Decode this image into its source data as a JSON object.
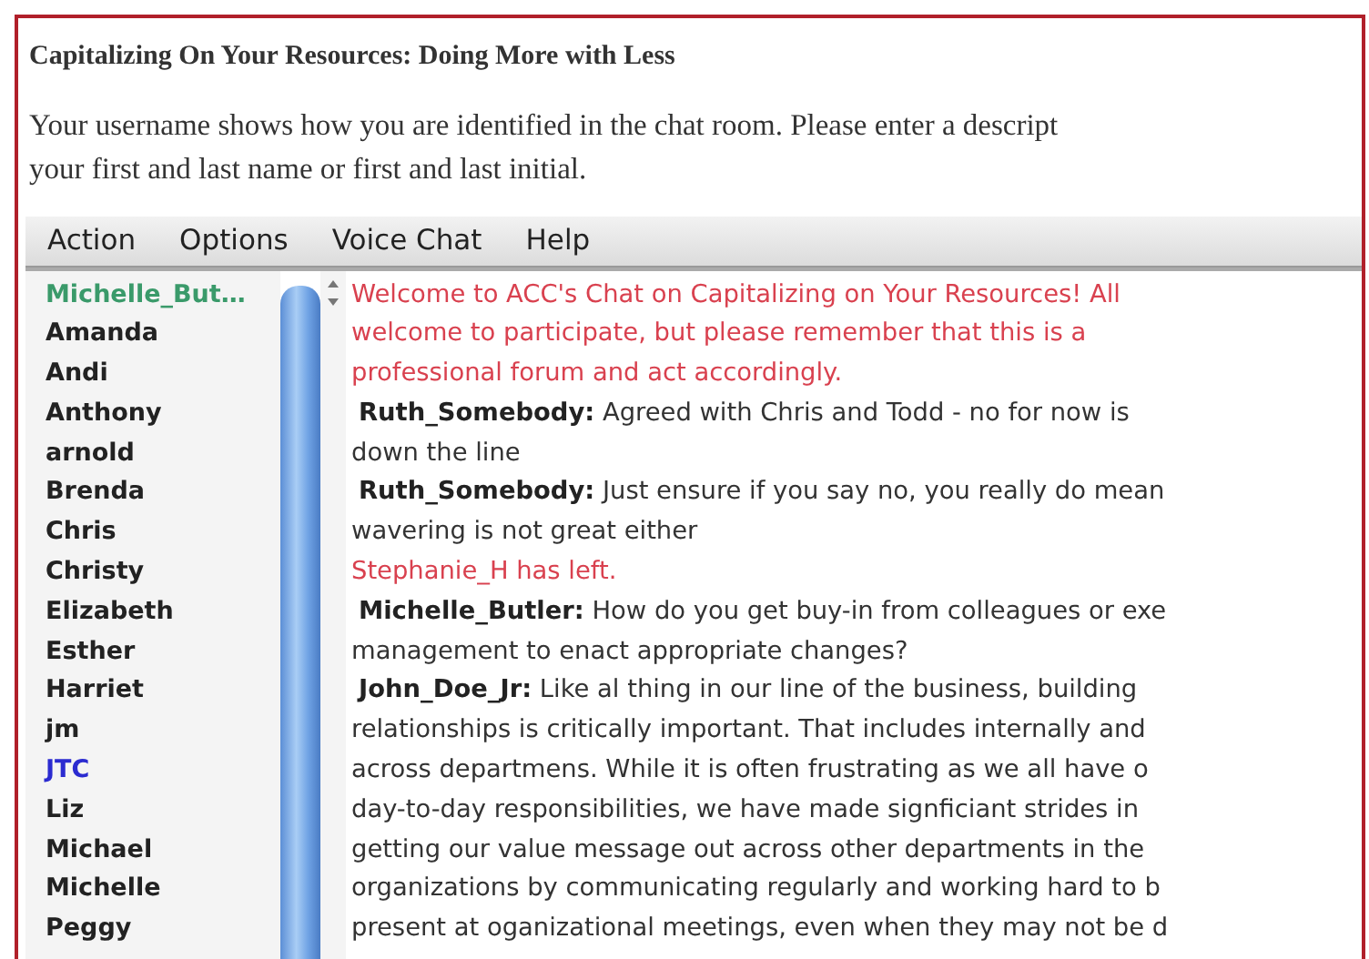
{
  "page": {
    "title": "Capitalizing On Your Resources: Doing More with Less",
    "intro_lines": [
      "Your username shows how you are identified in the chat room. Please enter a descript",
      "your first and last name or first and last initial."
    ]
  },
  "menu": [
    "Action",
    "Options",
    "Voice Chat",
    "Help"
  ],
  "users": [
    {
      "name": "Michelle_But…",
      "color": "#3a9a6a"
    },
    {
      "name": "Amanda",
      "color": "#222222"
    },
    {
      "name": "Andi",
      "color": "#222222"
    },
    {
      "name": "Anthony",
      "color": "#222222"
    },
    {
      "name": "arnold",
      "color": "#222222"
    },
    {
      "name": "Brenda",
      "color": "#222222"
    },
    {
      "name": "Chris",
      "color": "#222222"
    },
    {
      "name": "Christy",
      "color": "#222222"
    },
    {
      "name": "Elizabeth",
      "color": "#222222"
    },
    {
      "name": "Esther",
      "color": "#222222"
    },
    {
      "name": "Harriet",
      "color": "#222222"
    },
    {
      "name": "jm",
      "color": "#222222"
    },
    {
      "name": "JTC",
      "color": "#2b2bd0"
    },
    {
      "name": "Liz",
      "color": "#222222"
    },
    {
      "name": "Michael",
      "color": "#222222"
    },
    {
      "name": "Michelle",
      "color": "#222222"
    },
    {
      "name": "Peggy",
      "color": "#222222"
    }
  ],
  "messages": [
    {
      "kind": "system",
      "lines": [
        "Welcome to ACC's Chat on Capitalizing on Your Resources!  All",
        "welcome to participate, but please remember that this is a",
        "professional forum and act accordingly."
      ]
    },
    {
      "kind": "user",
      "author": "Ruth_Somebody:",
      "lines": [
        "Agreed with Chris and Todd - no for now is",
        "down the line"
      ]
    },
    {
      "kind": "user",
      "author": "Ruth_Somebody:",
      "lines": [
        "Just ensure if you say no, you really do mean",
        "wavering is not great either"
      ]
    },
    {
      "kind": "system",
      "lines": [
        "Stephanie_H has left."
      ]
    },
    {
      "kind": "user",
      "author": "Michelle_Butler:",
      "lines": [
        "How do you get buy-in from colleagues or exe",
        "management to enact appropriate changes?"
      ]
    },
    {
      "kind": "user",
      "author": "John_Doe_Jr:",
      "lines": [
        "Like al thing in our line of the business, building",
        "relationships is critically important.  That includes internally and",
        "across departmens.  While it is often frustrating as we all have o",
        "day-to-day responsibilities, we have made signficiant strides in",
        "getting our value message out across other departments in the",
        "organizations by communicating regularly and working hard to b",
        "present at oganizational meetings, even when they may not be d"
      ]
    }
  ]
}
